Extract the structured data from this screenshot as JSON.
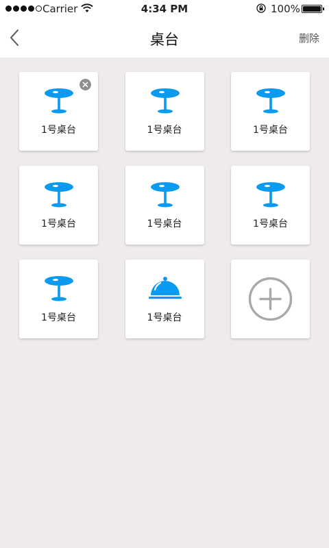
{
  "status_bar": {
    "carrier": "Carrier",
    "time": "4:34 PM",
    "battery": "100%",
    "signal_bars": 4
  },
  "nav": {
    "title": "桌台",
    "delete_label": "删除",
    "back_icon": "chevron-left-icon"
  },
  "colors": {
    "accent": "#0a9bf0",
    "background": "#eeebea",
    "badge": "#8e8e8e",
    "add_outline": "#a9a9a9"
  },
  "tables": [
    {
      "label": "1号桌台",
      "icon": "table-icon",
      "removable": true
    },
    {
      "label": "1号桌台",
      "icon": "table-icon",
      "removable": false
    },
    {
      "label": "1号桌台",
      "icon": "table-icon",
      "removable": false
    },
    {
      "label": "1号桌台",
      "icon": "table-icon",
      "removable": false
    },
    {
      "label": "1号桌台",
      "icon": "table-icon",
      "removable": false
    },
    {
      "label": "1号桌台",
      "icon": "table-icon",
      "removable": false
    },
    {
      "label": "1号桌台",
      "icon": "table-icon",
      "removable": false
    },
    {
      "label": "1号桌台",
      "icon": "food-cloche-icon",
      "removable": false
    }
  ],
  "add_tile": {
    "icon": "add-circle-icon"
  }
}
